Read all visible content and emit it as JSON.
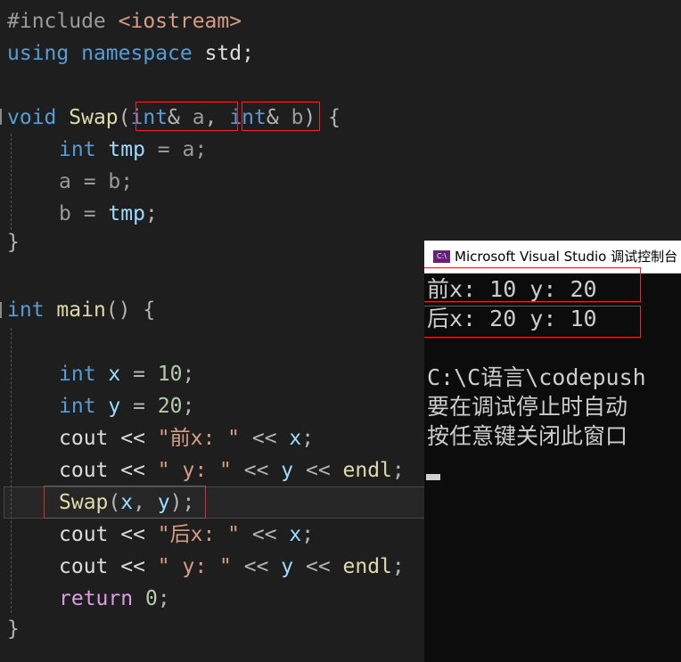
{
  "colors": {
    "editor_bg": "#1e1e1e",
    "keyword": "#569cd6",
    "function": "#dcdcaa",
    "variable": "#9cdcfe",
    "number": "#b5cea8",
    "string": "#d69d85",
    "control": "#d8a0df",
    "highlight_box": "#e8272a",
    "console_bg": "#0c0c0c",
    "console_text": "#cccccc"
  },
  "code": {
    "l1": {
      "directive": "#include",
      "header": " <iostream>"
    },
    "l2": {
      "using": "using",
      "namespace": "namespace",
      "rest": " std;"
    },
    "l4": {
      "void": "void",
      "fn": "Swap",
      "open": "(",
      "int1": "int",
      "amp1": "&",
      "a": " a",
      "comma": ", ",
      "int2": "int",
      "amp2": "&",
      "b": " b",
      "close": ") {"
    },
    "l5": {
      "int": "int",
      "tmp": "tmp",
      "rest": " = a;"
    },
    "l6": {
      "text": "a = b;"
    },
    "l7": {
      "b": "b = ",
      "tmp": "tmp",
      "semi": ";"
    },
    "l8": {
      "text": "}"
    },
    "l10": {
      "int": "int",
      "fn": "main",
      "rest": "() {"
    },
    "l12": {
      "int": "int",
      "x": "x",
      "eq": " = ",
      "num": "10",
      "semi": ";"
    },
    "l13": {
      "int": "int",
      "y": "y",
      "eq": " = ",
      "num": "20",
      "semi": ";"
    },
    "l14": {
      "cout": "cout << ",
      "str": "\"前x: \"",
      "op": " << ",
      "x": "x",
      "semi": ";"
    },
    "l15": {
      "cout": "cout << ",
      "str": "\" y: \"",
      "op1": " << ",
      "y": "y",
      "op2": " << ",
      "endl": "endl",
      "semi": ";"
    },
    "l16": {
      "fn": "Swap",
      "open": "(",
      "x": "x",
      "comma": ", ",
      "y": "y",
      "close": ");"
    },
    "l17": {
      "cout": "cout << ",
      "str": "\"后x: \"",
      "op": " << ",
      "x": "x",
      "semi": ";"
    },
    "l18": {
      "cout": "cout << ",
      "str": "\" y: \"",
      "op1": " << ",
      "y": "y",
      "op2": " << ",
      "endl": "endl",
      "semi": ";"
    },
    "l19": {
      "ret": "return",
      "sp": " ",
      "num": "0",
      "semi": ";"
    },
    "l20": {
      "text": "}"
    }
  },
  "console": {
    "icon_label": "C:\\",
    "title": "Microsoft Visual Studio 调试控制台",
    "lines": [
      "前x: 10 y: 20",
      "后x: 20 y: 10",
      "",
      "C:\\C语言\\codepush",
      "要在调试停止时自动",
      "按任意键关闭此窗口"
    ]
  }
}
